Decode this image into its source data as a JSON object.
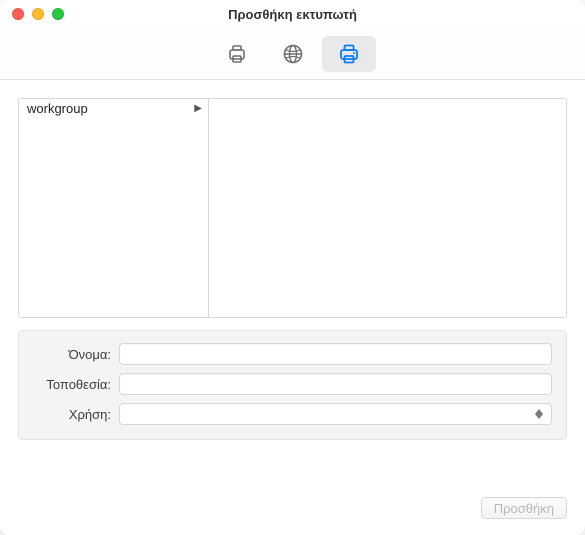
{
  "window": {
    "title": "Προσθήκη εκτυπωτή"
  },
  "toolbar": {
    "tabs": [
      {
        "name": "default-tab",
        "selected": false
      },
      {
        "name": "ip-tab",
        "selected": false
      },
      {
        "name": "windows-tab",
        "selected": true
      }
    ]
  },
  "browser": {
    "left": [
      {
        "label": "workgroup",
        "hasChildren": true
      }
    ]
  },
  "form": {
    "name_label": "Όνομα:",
    "name_value": "",
    "location_label": "Τοποθεσία:",
    "location_value": "",
    "use_label": "Χρήση:",
    "use_value": ""
  },
  "footer": {
    "add_label": "Προσθήκη",
    "add_enabled": false
  }
}
